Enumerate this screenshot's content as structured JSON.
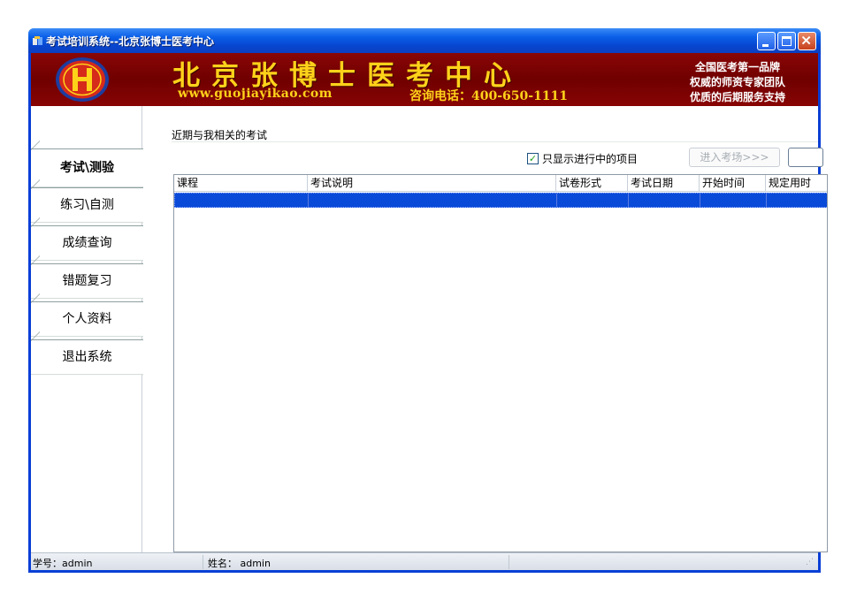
{
  "window": {
    "title": "考试培训系统--北京张博士医考中心"
  },
  "banner": {
    "title": "北京张博士医考中心",
    "url": "www.guojiayikao.com",
    "phone": "咨询电话：400-650-1111",
    "slogans": [
      "全国医考第一品牌",
      "权威的师资专家团队",
      "优质的后期服务支持"
    ]
  },
  "sidebar": {
    "items": [
      {
        "label": "考试\\测验"
      },
      {
        "label": "练习\\自测"
      },
      {
        "label": "成绩查询"
      },
      {
        "label": "错题复习"
      },
      {
        "label": "个人资料"
      },
      {
        "label": "退出系统"
      }
    ],
    "active_index": 0
  },
  "main": {
    "section_label": "近期与我相关的考试",
    "filter_checkbox_label": "只显示进行中的项目",
    "filter_checked": true,
    "enter_button": "进入考场>>>",
    "table": {
      "columns": [
        "课程",
        "考试说明",
        "试卷形式",
        "考试日期",
        "开始时间",
        "规定用时"
      ],
      "rows": [
        [
          "",
          "",
          "",
          "",
          "",
          ""
        ]
      ]
    }
  },
  "statusbar": {
    "student_id_label": "学号：admin",
    "name_label": "姓名：  admin"
  },
  "colors": {
    "banner_bg": "#7a0202",
    "banner_text": "#ffd21a",
    "selection": "#0a4ad8",
    "titlebar": "#0a5fe8"
  }
}
